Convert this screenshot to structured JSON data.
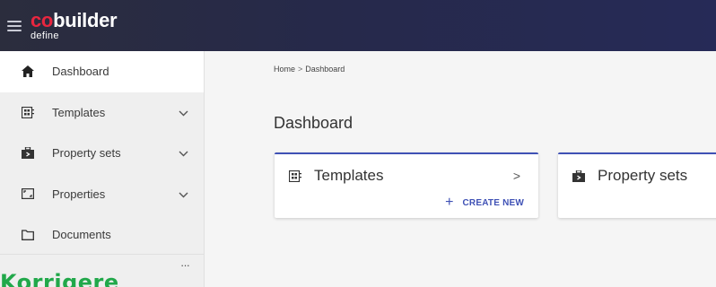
{
  "app": {
    "logo_co": "co",
    "logo_rest": "builder",
    "logo_sub": "define"
  },
  "sidebar": {
    "items": [
      {
        "label": "Dashboard",
        "icon": "home-icon",
        "active": true
      },
      {
        "label": "Templates",
        "icon": "templates-icon",
        "expandable": true
      },
      {
        "label": "Property sets",
        "icon": "property-sets-icon",
        "expandable": true
      },
      {
        "label": "Properties",
        "icon": "properties-icon",
        "expandable": true
      },
      {
        "label": "Documents",
        "icon": "folder-icon"
      }
    ],
    "overlay_text": "Korrigere",
    "more_label": "···"
  },
  "breadcrumb": {
    "home": "Home",
    "separator": ">",
    "current": "Dashboard"
  },
  "main": {
    "title": "Dashboard",
    "cards": [
      {
        "title": "Templates",
        "arrow": ">",
        "create_new": "CREATE NEW",
        "create_plus": "+"
      },
      {
        "title": "Property sets"
      }
    ]
  },
  "colors": {
    "accent": "#3f51b5",
    "brand_red": "#e8263f",
    "overlay_green": "#21a84a"
  }
}
